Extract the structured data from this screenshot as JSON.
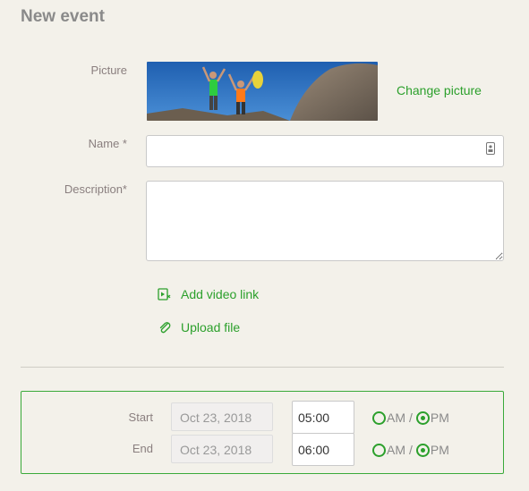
{
  "page": {
    "title": "New event"
  },
  "picture": {
    "label": "Picture",
    "change_label": "Change picture"
  },
  "name": {
    "label": "Name *",
    "value": "",
    "placeholder": ""
  },
  "description": {
    "label": "Description*",
    "value": "",
    "placeholder": ""
  },
  "attachments": {
    "video_label": "Add video link",
    "upload_label": "Upload file"
  },
  "schedule": {
    "start": {
      "label": "Start",
      "date": "Oct 23, 2018",
      "time": "05:00",
      "am_label": "AM",
      "pm_label": "PM",
      "separator": "/",
      "selected": "PM"
    },
    "end": {
      "label": "End",
      "date": "Oct 23, 2018",
      "time": "06:00",
      "am_label": "AM",
      "pm_label": "PM",
      "separator": "/",
      "selected": "PM"
    }
  },
  "colors": {
    "accent": "#2ca02c",
    "border": "#3aaa3a",
    "background": "#f3f1ea"
  }
}
